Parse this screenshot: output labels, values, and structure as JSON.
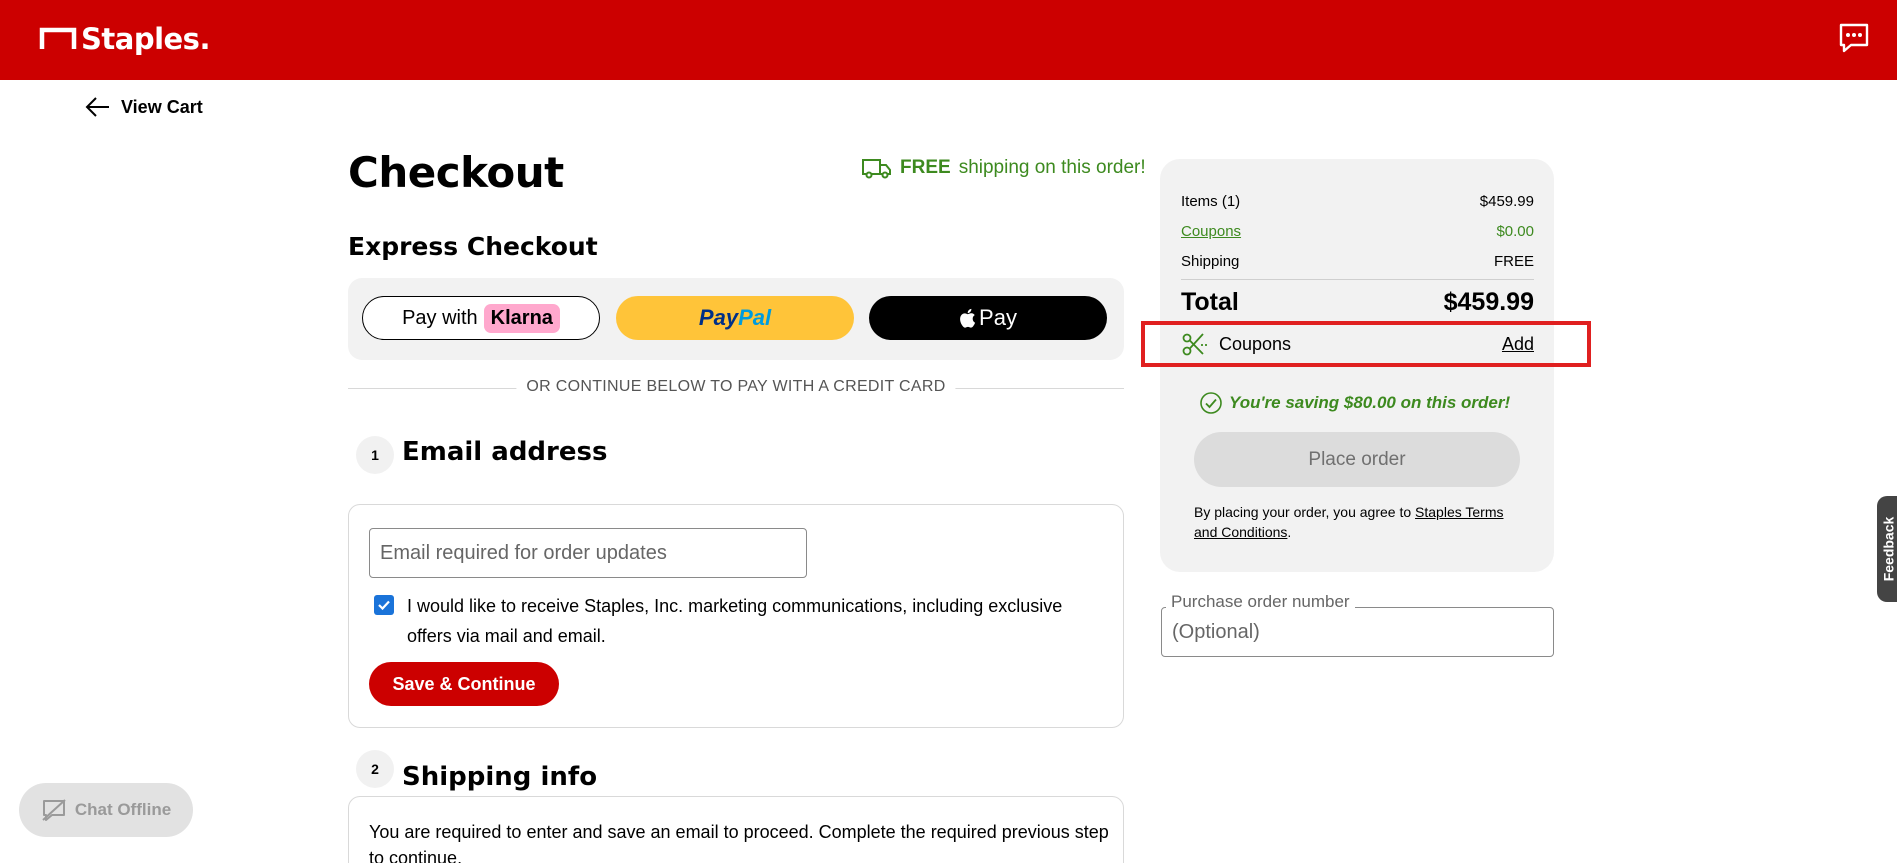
{
  "header": {
    "logo_text": "Staples.",
    "chat_icon": "chat-bubble-icon",
    "brand_color": "#cc0000"
  },
  "nav": {
    "back_label": "View Cart"
  },
  "page": {
    "title": "Checkout"
  },
  "shipping_banner": {
    "bold": "FREE",
    "text": "shipping on this order!"
  },
  "express": {
    "title": "Express Checkout",
    "klarna_prefix": "Pay with",
    "klarna_brand": "Klarna",
    "paypal_a": "Pay",
    "paypal_b": "Pal",
    "apple_label": "Pay"
  },
  "divider_text": "OR CONTINUE BELOW TO PAY WITH A CREDIT CARD",
  "step1": {
    "number": "1",
    "title": "Email address",
    "email_placeholder": "Email required for order updates",
    "marketing_label": "I would like to receive Staples, Inc. marketing communications, including exclusive offers via mail and email.",
    "marketing_checked": true,
    "save_button": "Save & Continue"
  },
  "step2": {
    "number": "2",
    "title": "Shipping info",
    "message": "You are required to enter and save an email to proceed. Complete the required previous step to continue."
  },
  "summary": {
    "items_label": "Items (1)",
    "items_value": "$459.99",
    "coupons_label": "Coupons",
    "coupons_value": "$0.00",
    "shipping_label": "Shipping",
    "shipping_value": "FREE",
    "total_label": "Total",
    "total_value": "$459.99",
    "coupon_row_label": "Coupons",
    "coupon_add": "Add",
    "saving_text": "You're saving $80.00 on this order!",
    "place_order": "Place order",
    "agree_prefix": "By placing your order, you agree to ",
    "agree_link": "Staples Terms and Conditions",
    "agree_suffix": "."
  },
  "purchase_order": {
    "label": "Purchase order number",
    "placeholder": "(Optional)"
  },
  "feedback_label": "Feedback",
  "chat_offline_label": "Chat Offline",
  "colors": {
    "accent_green": "#3d8a1f",
    "highlight_red": "#e02020",
    "checkbox_blue": "#1a73d9"
  }
}
